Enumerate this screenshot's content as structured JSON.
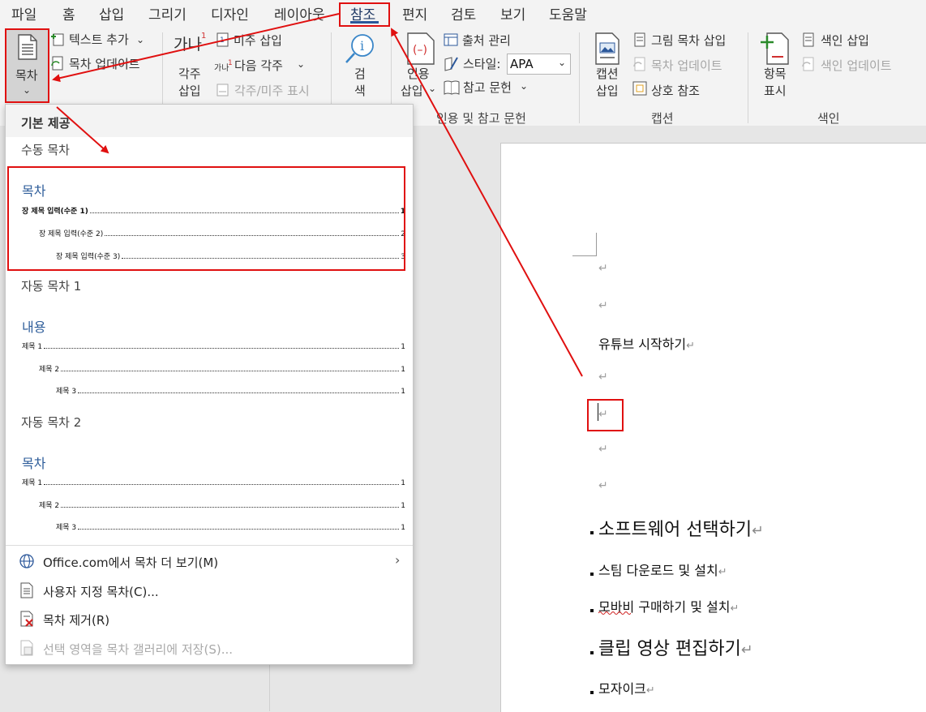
{
  "tabs": [
    "파일",
    "홈",
    "삽입",
    "그리기",
    "디자인",
    "레이아웃",
    "참조",
    "편지",
    "검토",
    "보기",
    "도움말"
  ],
  "ribbon": {
    "toc": {
      "label": "목차",
      "add_text": "텍스트 추가",
      "update": "목차 업데이트"
    },
    "footnotes": {
      "insert_footnote_1": "각주",
      "insert_footnote_2": "삽입",
      "insert_endnote": "미주 삽입",
      "next_footnote": "다음 각주",
      "show_notes": "각주/미주 표시",
      "icon_text": "가나",
      "icon_small": "가나",
      "superscript": "1",
      "chevron": "⌄"
    },
    "research": {
      "search_1": "검",
      "search_2": "색"
    },
    "citations": {
      "insert_citation_1": "인용",
      "insert_citation_2": "삽입",
      "manage_sources": "출처 관리",
      "style_label": "스타일:",
      "style_value": "APA",
      "bibliography": "참고 문헌",
      "group_label": "인용 및 참고 문헌"
    },
    "captions": {
      "insert_caption_1": "캡션",
      "insert_caption_2": "삽입",
      "insert_table_of_figures": "그림 목차 삽입",
      "update_table": "목차 업데이트",
      "cross_reference": "상호 참조",
      "group_label": "캡션"
    },
    "index": {
      "mark_entry_1": "항목",
      "mark_entry_2": "표시",
      "insert_index": "색인 삽입",
      "update_index": "색인 업데이트",
      "group_label": "색인"
    }
  },
  "dropdown": {
    "builtin_header": "기본 제공",
    "manual_toc": "수동 목차",
    "manual_sample": {
      "title": "목차",
      "lines": [
        {
          "text": "장 제목 입력(수준 1)",
          "page": "1"
        },
        {
          "text": "장 제목 입력(수준 2)",
          "page": "2"
        },
        {
          "text": "장 제목 입력(수준 3)",
          "page": "3"
        }
      ]
    },
    "auto_toc_1": "자동 목차 1",
    "auto1_sample": {
      "title": "내용",
      "lines": [
        {
          "text": "제목 1",
          "page": "1"
        },
        {
          "text": "제목 2",
          "page": "1"
        },
        {
          "text": "제목 3",
          "page": "1"
        }
      ]
    },
    "auto_toc_2": "자동 목차 2",
    "auto2_sample": {
      "title": "목차",
      "lines": [
        {
          "text": "제목 1",
          "page": "1"
        },
        {
          "text": "제목 2",
          "page": "1"
        },
        {
          "text": "제목 3",
          "page": "1"
        }
      ]
    },
    "menu": {
      "more_office": "Office.com에서 목차 더 보기(M)",
      "custom_toc": "사용자 지정 목차(C)...",
      "remove_toc": "목차 제거(R)",
      "save_selection": "선택 영역을 목차 갤러리에 저장(S)..."
    }
  },
  "document": {
    "paragraph_mark": "↵",
    "lines": [
      "유튜브 시작하기",
      "소프트웨어 선택하기",
      "스팀 다운로드 및 설치",
      "모바비 구매하기 및 설치",
      "클립 영상 편집하기",
      "모자이크"
    ]
  },
  "colors": {
    "accent": "#2b579a",
    "annotation": "#e01010",
    "heading_blue": "#2e5d9a"
  }
}
